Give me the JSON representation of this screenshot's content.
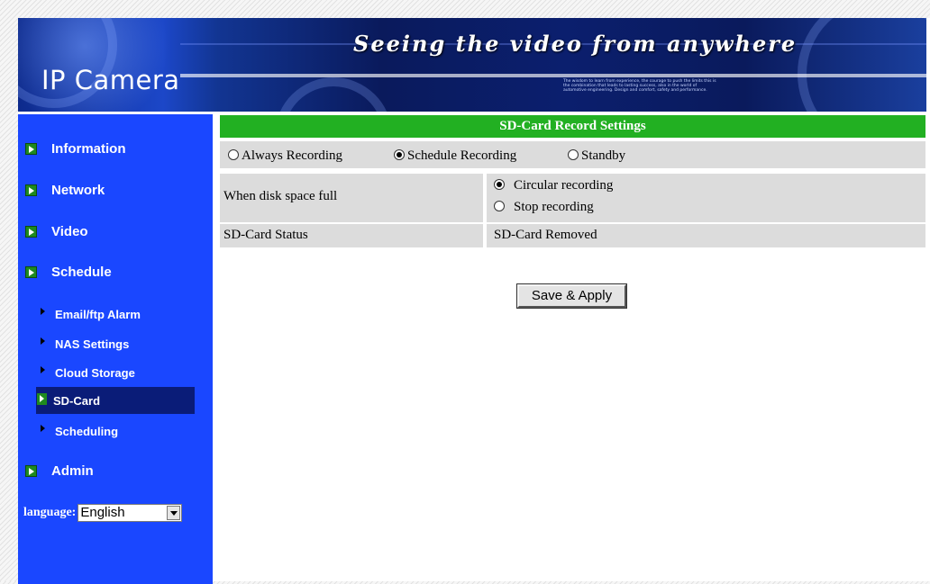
{
  "header": {
    "brand": "IP Camera",
    "slogan": "Seeing the video from anywhere",
    "fine_print": "The wisdom to learn from experience, the courage to push the limits this is the combination that leads to lasting success, also in the world of automotive engineering. Design and comfort, safety and performance."
  },
  "sidebar": {
    "menu": [
      {
        "label": "Information"
      },
      {
        "label": "Network"
      },
      {
        "label": "Video"
      },
      {
        "label": "Schedule"
      }
    ],
    "submenu": [
      {
        "label": "Email/ftp Alarm"
      },
      {
        "label": "NAS Settings"
      },
      {
        "label": "Cloud Storage"
      },
      {
        "label": "SD-Card",
        "active": true
      },
      {
        "label": "Scheduling"
      }
    ],
    "admin": {
      "label": "Admin"
    },
    "language": {
      "label": "language:",
      "selected": "English"
    }
  },
  "main": {
    "title": "SD-Card Record Settings",
    "mode_options": [
      {
        "label": "Always Recording",
        "selected": false
      },
      {
        "label": "Schedule Recording",
        "selected": true
      },
      {
        "label": "Standby",
        "selected": false
      }
    ],
    "disk_full": {
      "label": "When disk space full",
      "options": [
        {
          "label": "Circular recording",
          "selected": true
        },
        {
          "label": "Stop recording",
          "selected": false
        }
      ]
    },
    "status": {
      "label": "SD-Card Status",
      "value": "SD-Card Removed"
    },
    "save_button": "Save & Apply"
  },
  "colors": {
    "sidebar_bg": "#1a47ff",
    "header_green": "#22b022",
    "active_item": "#0a1c78",
    "row_gray": "#dcdcdc"
  }
}
